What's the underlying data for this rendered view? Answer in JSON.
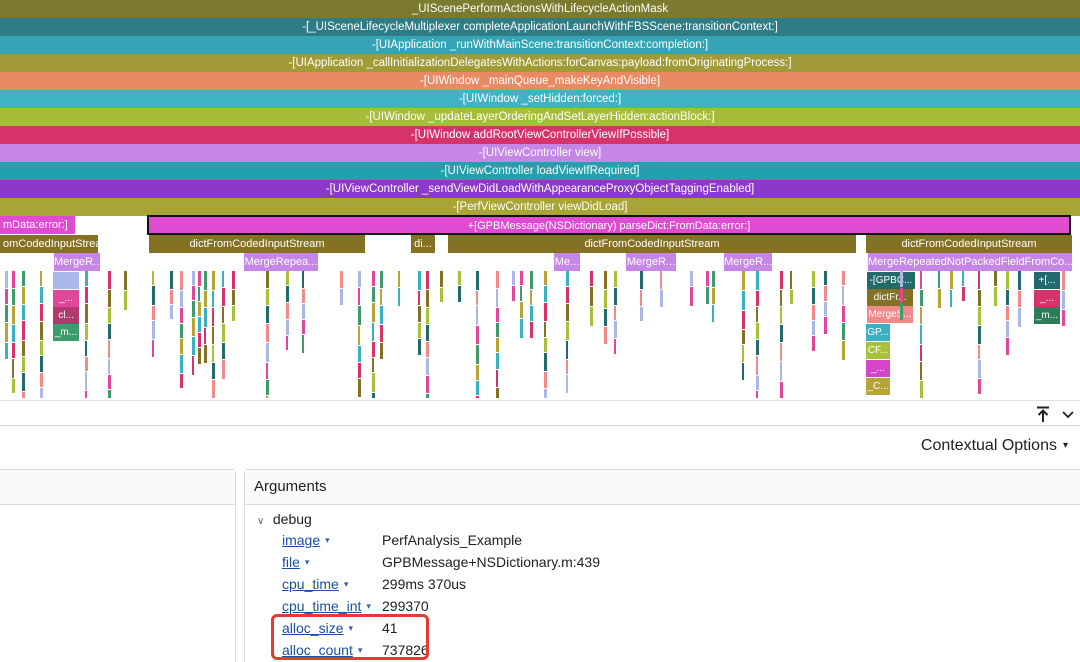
{
  "flame": {
    "rows": [
      {
        "label": "_UIScenePerformActionsWithLifecycleActionMask",
        "color": "#7b7a2e"
      },
      {
        "label": "-[_UISceneLifecycleMultiplexer completeApplicationLaunchWithFBSScene:transitionContext:]",
        "color": "#2e7c86"
      },
      {
        "label": "-[UIApplication _runWithMainScene:transitionContext:completion:]",
        "color": "#35a5b5"
      },
      {
        "label": "-[UIApplication _callInitializationDelegatesWithActions:forCanvas:payload:fromOriginatingProcess:]",
        "color": "#a19a36"
      },
      {
        "label": "-[UIWindow _mainQueue_makeKeyAndVisible]",
        "color": "#e98a65"
      },
      {
        "label": "-[UIWindow _setHidden:forced:]",
        "color": "#3fb3c4"
      },
      {
        "label": "-[UIWindow _updateLayerOrderingAndSetLayerHidden:actionBlock:]",
        "color": "#a6bd3a"
      },
      {
        "label": "-[UIWindow addRootViewControllerViewIfPossible]",
        "color": "#d6336c"
      },
      {
        "label": "-[UIViewController view]",
        "color": "#c586e6"
      },
      {
        "label": "-[UIViewController loadViewIfRequired]",
        "color": "#22a0ac"
      },
      {
        "label": "-[UIViewController _sendViewDidLoadWithAppearanceProxyObjectTaggingEnabled]",
        "color": "#8b39c8"
      },
      {
        "label": "-[PerfViewController viewDidLoad]",
        "color": "#a8a435"
      }
    ],
    "selected": {
      "label": "+[GPBMessage(NSDictionary) parseDict:FromData:error:]",
      "color": "#e04cd1"
    },
    "left_partial": {
      "label": "mData:error:]",
      "color": "#e04cd1"
    },
    "dict_blocks": [
      {
        "label": "omCodedInputStream",
        "color": "#857124"
      },
      {
        "label": "dictFromCodedInputStream",
        "color": "#857124"
      },
      {
        "label": "di...",
        "color": "#857124"
      },
      {
        "label": "dictFromCodedInputStream",
        "color": "#857124"
      },
      {
        "label": "dictFromCodedInputStream",
        "color": "#857124"
      }
    ],
    "merge_blocks": [
      {
        "label": "MergeR...",
        "color": "#c586e6"
      },
      {
        "label": "MergeRepea...",
        "color": "#c586e6"
      },
      {
        "label": "Me...",
        "color": "#c586e6"
      },
      {
        "label": "MergeR...",
        "color": "#c586e6"
      },
      {
        "label": "MergeR...",
        "color": "#c586e6"
      },
      {
        "label": "MergeRepeatedNotPackedFieldFromCo...",
        "color": "#c586e6"
      }
    ],
    "small_blocks_left": [
      {
        "label": "",
        "color": "#a9b8e8"
      },
      {
        "label": "_...",
        "color": "#e0479a"
      },
      {
        "label": "cl...",
        "color": "#b03a6e"
      },
      {
        "label": "_m...",
        "color": "#3f9b6b"
      }
    ],
    "stack_right": [
      {
        "label": "-[GPBC...",
        "color": "#236b6b"
      },
      {
        "label": "dictFr...",
        "color": "#857124"
      },
      {
        "label": "MergeS...",
        "color": "#f08a8a"
      },
      {
        "label": "GP...",
        "color": "#3ab1c2"
      },
      {
        "label": "CF...",
        "color": "#a7c23a"
      },
      {
        "label": "_...",
        "color": "#d645c9"
      },
      {
        "label": "_C...",
        "color": "#b6a437"
      }
    ],
    "stack_far_right": [
      {
        "label": "+[...",
        "color": "#236b6b"
      },
      {
        "label": "_...",
        "color": "#d6336c"
      },
      {
        "label": "_m...",
        "color": "#2e7d5a"
      }
    ]
  },
  "toolbar": {
    "contextual_options": "Contextual Options",
    "caret": "▾"
  },
  "arguments": {
    "title": "Arguments",
    "group": "debug",
    "items": [
      {
        "key": "image",
        "value": "PerfAnalysis_Example"
      },
      {
        "key": "file",
        "value": "GPBMessage+NSDictionary.m:439"
      },
      {
        "key": "cpu_time",
        "value": "299ms 370us"
      },
      {
        "key": "cpu_time_int",
        "value": "299370"
      },
      {
        "key": "alloc_size",
        "value": "41"
      },
      {
        "key": "alloc_count",
        "value": "737826"
      }
    ]
  }
}
